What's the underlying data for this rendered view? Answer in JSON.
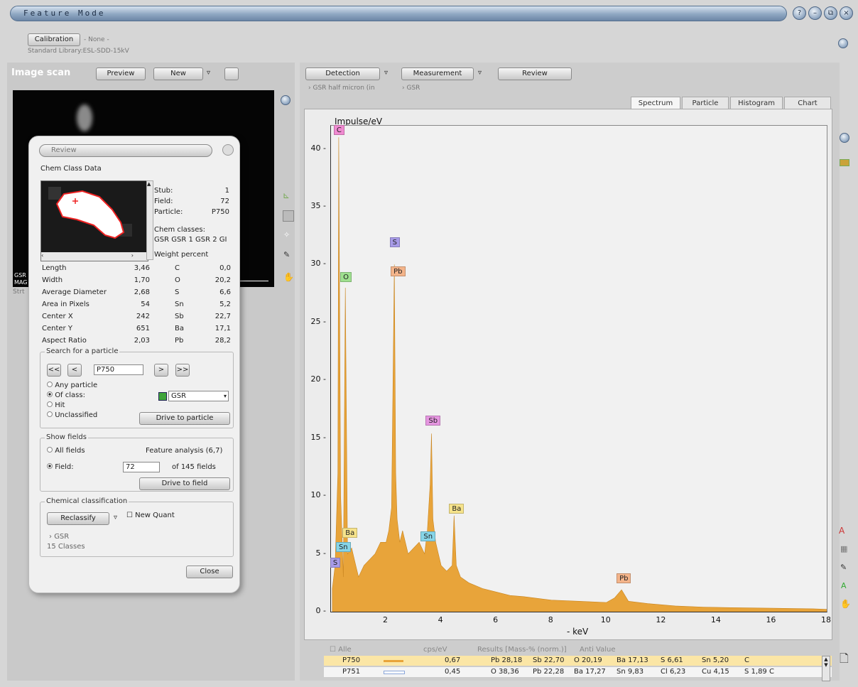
{
  "window": {
    "title": "Feature Mode",
    "buttons": [
      "?",
      "–",
      "⧉",
      "×"
    ]
  },
  "calibration": {
    "button": "Calibration",
    "value": "- None -",
    "library": "Standard Library:ESL-SDD-15kV"
  },
  "image_scan": {
    "title": "Image scan",
    "preview": "Preview",
    "new": "New",
    "overlay": [
      "GSR",
      "MAG",
      "Strt"
    ]
  },
  "toolbar": {
    "detection": "Detection",
    "measurement": "Measurement",
    "review": "Review",
    "breadcrumb_1": "GSR half micron (in",
    "breadcrumb_2": "GSR"
  },
  "tabs": [
    "Spectrum",
    "Particle",
    "Histogram",
    "Chart"
  ],
  "dialog": {
    "title": "Review",
    "section": "Chem Class Data",
    "info": [
      {
        "label": "Stub:",
        "value": "1"
      },
      {
        "label": "Field:",
        "value": "72"
      },
      {
        "label": "Particle:",
        "value": "P750"
      }
    ],
    "chem_classes_label": "Chem classes:",
    "chem_classes": "GSR GSR 1 GSR 2 GI",
    "weight_percent_label": "Weight percent",
    "measures": [
      {
        "label": "Length",
        "value": "3,46",
        "el": "C",
        "wt": "0,0"
      },
      {
        "label": "Width",
        "value": "1,70",
        "el": "O",
        "wt": "20,2"
      },
      {
        "label": "Average Diameter",
        "value": "2,68",
        "el": "S",
        "wt": "6,6"
      },
      {
        "label": "Area in Pixels",
        "value": "54",
        "el": "Sn",
        "wt": "5,2"
      },
      {
        "label": "Center X",
        "value": "242",
        "el": "Sb",
        "wt": "22,7"
      },
      {
        "label": "Center Y",
        "value": "651",
        "el": "Ba",
        "wt": "17,1"
      },
      {
        "label": "Aspect Ratio",
        "value": "2,03",
        "el": "Pb",
        "wt": "28,2"
      }
    ],
    "search": {
      "legend": "Search for a particle",
      "nav": [
        "<<",
        "<",
        ">",
        ">>"
      ],
      "particle_value": "P750",
      "options": [
        "Any particle",
        "Of class:",
        "Hit",
        "Unclassified"
      ],
      "selected": 1,
      "class_value": "GSR",
      "class_color": "#3fa43a",
      "drive": "Drive to particle"
    },
    "fields": {
      "legend": "Show fields",
      "all": "All fields",
      "analysis": "Feature analysis (6,7)",
      "field_label": "Field:",
      "field_value": "72",
      "of_fields": "of 145 fields",
      "drive": "Drive to field"
    },
    "chem_class": {
      "legend": "Chemical classification",
      "reclassify": "Reclassify",
      "new_quant": "New Quant",
      "tree_item": "GSR",
      "count": "15 Classes"
    },
    "close": "Close"
  },
  "chart_data": {
    "type": "area",
    "title": "",
    "ylabel": "Impulse/eV",
    "xlabel": "keV",
    "xlim": [
      0,
      18
    ],
    "ylim": [
      0,
      42
    ],
    "xticks": [
      "2",
      "4",
      "6",
      "8",
      "10",
      "12",
      "14",
      "16",
      "18"
    ],
    "yticks": [
      "0",
      "5",
      "10",
      "15",
      "20",
      "25",
      "30",
      "35",
      "40"
    ],
    "grid": false,
    "color": "#e8a43a",
    "series": [
      {
        "x": [
          0.05,
          0.15,
          0.25,
          0.28,
          0.35,
          0.45,
          0.52,
          0.6,
          0.75,
          0.9,
          1.0,
          1.2,
          1.4,
          1.6,
          1.8,
          2.0,
          2.1,
          2.2,
          2.3,
          2.35,
          2.4,
          2.5,
          2.6,
          2.8,
          3.0,
          3.2,
          3.4,
          3.5,
          3.6,
          3.65,
          3.7,
          3.8,
          3.9,
          4.0,
          4.2,
          4.4,
          4.47,
          4.55,
          4.7,
          5.0,
          5.5,
          6.0,
          6.5,
          7.0,
          8.0,
          9.0,
          10.0,
          10.3,
          10.55,
          10.8,
          11.5,
          12.5,
          13.5,
          14.5,
          16.0,
          17.5,
          18.0
        ],
        "y": [
          2,
          4,
          12,
          41,
          10,
          3,
          28,
          5,
          5.5,
          4,
          3,
          4,
          4.5,
          5,
          6,
          6,
          7,
          9,
          30,
          12,
          8,
          6,
          7,
          5,
          5.5,
          6,
          5,
          7,
          11,
          15.4,
          8,
          6,
          5,
          4,
          3.5,
          4,
          8.3,
          4,
          3,
          2.5,
          2,
          1.7,
          1.4,
          1.3,
          1.0,
          0.9,
          0.8,
          1.2,
          1.9,
          0.9,
          0.7,
          0.5,
          0.4,
          0.35,
          0.3,
          0.25,
          0.2
        ]
      }
    ],
    "peaks": [
      {
        "label": "C",
        "x": 0.28,
        "y": 41,
        "color": "#f08ad1"
      },
      {
        "label": "O",
        "x": 0.52,
        "y": 28.3,
        "color": "#9fe08f"
      },
      {
        "label": "S",
        "x": 2.31,
        "y": 31.3,
        "color": "#a79be8"
      },
      {
        "label": "Pb",
        "x": 2.35,
        "y": 28.8,
        "color": "#f4b48a"
      },
      {
        "label": "Sb",
        "x": 3.62,
        "y": 15.9,
        "color": "#e596e0"
      },
      {
        "label": "Ba",
        "x": 4.47,
        "y": 8.3,
        "color": "#f6e38b"
      },
      {
        "label": "Sn",
        "x": 3.44,
        "y": 5.9,
        "color": "#86d5e8"
      },
      {
        "label": "Ba",
        "x": 0.6,
        "y": 6.2,
        "color": "#f6e38b"
      },
      {
        "label": "Sn",
        "x": 0.36,
        "y": 5.0,
        "color": "#86d5e8"
      },
      {
        "label": "S",
        "x": 0.15,
        "y": 3.6,
        "color": "#a79be8"
      },
      {
        "label": "Pb",
        "x": 10.55,
        "y": 2.3,
        "color": "#f4b48a"
      }
    ]
  },
  "results_table": {
    "header": [
      "Alle",
      "cps/eV",
      "Results [Mass-% (norm.)]",
      "Anti Value"
    ],
    "rows": [
      {
        "name": "P750",
        "line": "#e8a43a",
        "cps": "0,67",
        "r1": "Pb 28,18",
        "r2": "Sb 22,70",
        "r3": "O 20,19",
        "r4": "Ba 17,13",
        "r5": "S 6,61",
        "r6": "Sn 5,20",
        "r7": "C"
      },
      {
        "name": "P751",
        "line": "#8aa6d8",
        "cps": "0,45",
        "r1": "O 38,36",
        "r2": "Pb 22,28",
        "r3": "Ba 17,27",
        "r4": "Sn 9,83",
        "r5": "Cl 6,23",
        "r6": "Cu 4,15",
        "r7": "S 1,89  C"
      }
    ]
  }
}
